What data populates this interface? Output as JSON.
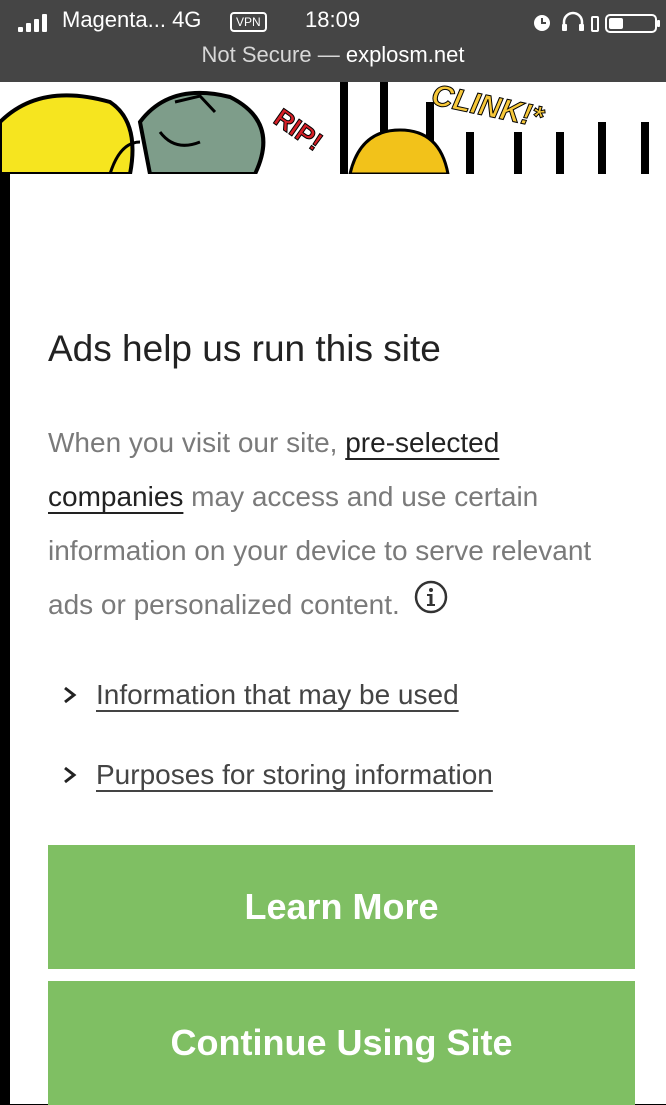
{
  "status_bar": {
    "carrier": "Magenta... 4G",
    "vpn_badge": "VPN",
    "time": "18:09",
    "icons": [
      "alarm-icon",
      "headphones-icon",
      "battery-icon"
    ]
  },
  "browser": {
    "security_label": "Not Secure —",
    "host": "explosm.net"
  },
  "banner": {
    "sfx_left": "RIP!",
    "sfx_right": "CLINK!*"
  },
  "consent": {
    "title": "Ads help us run this site",
    "body_before": "When you visit our site, ",
    "companies_link": "pre-selected companies",
    "body_after": " may access and use certain information on your device to serve relevant ads or personalized content.",
    "info_icon": "info-icon",
    "disclosures": [
      {
        "label": "Information that may be used"
      },
      {
        "label": "Purposes for storing information"
      }
    ],
    "learn_more_label": "Learn More",
    "continue_label": "Continue Using Site",
    "accent_color": "#7fbf63"
  }
}
